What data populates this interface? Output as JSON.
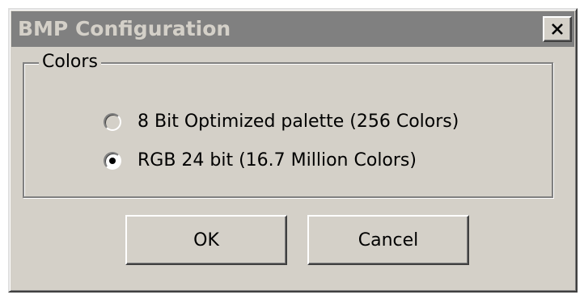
{
  "window": {
    "title": "BMP Configuration",
    "close_icon": "close-x-icon"
  },
  "colors_group": {
    "label": "Colors",
    "options": [
      {
        "label": "8 Bit Optimized palette  (256 Colors)",
        "selected": false,
        "enabled": false
      },
      {
        "label": "RGB 24 bit  (16.7 Million Colors)",
        "selected": true,
        "enabled": true
      }
    ]
  },
  "buttons": {
    "ok_label": "OK",
    "cancel_label": "Cancel"
  },
  "theme": {
    "face": "#d4d0c8",
    "titlebar_inactive": "#808080",
    "title_text": "#d4d0c8"
  }
}
